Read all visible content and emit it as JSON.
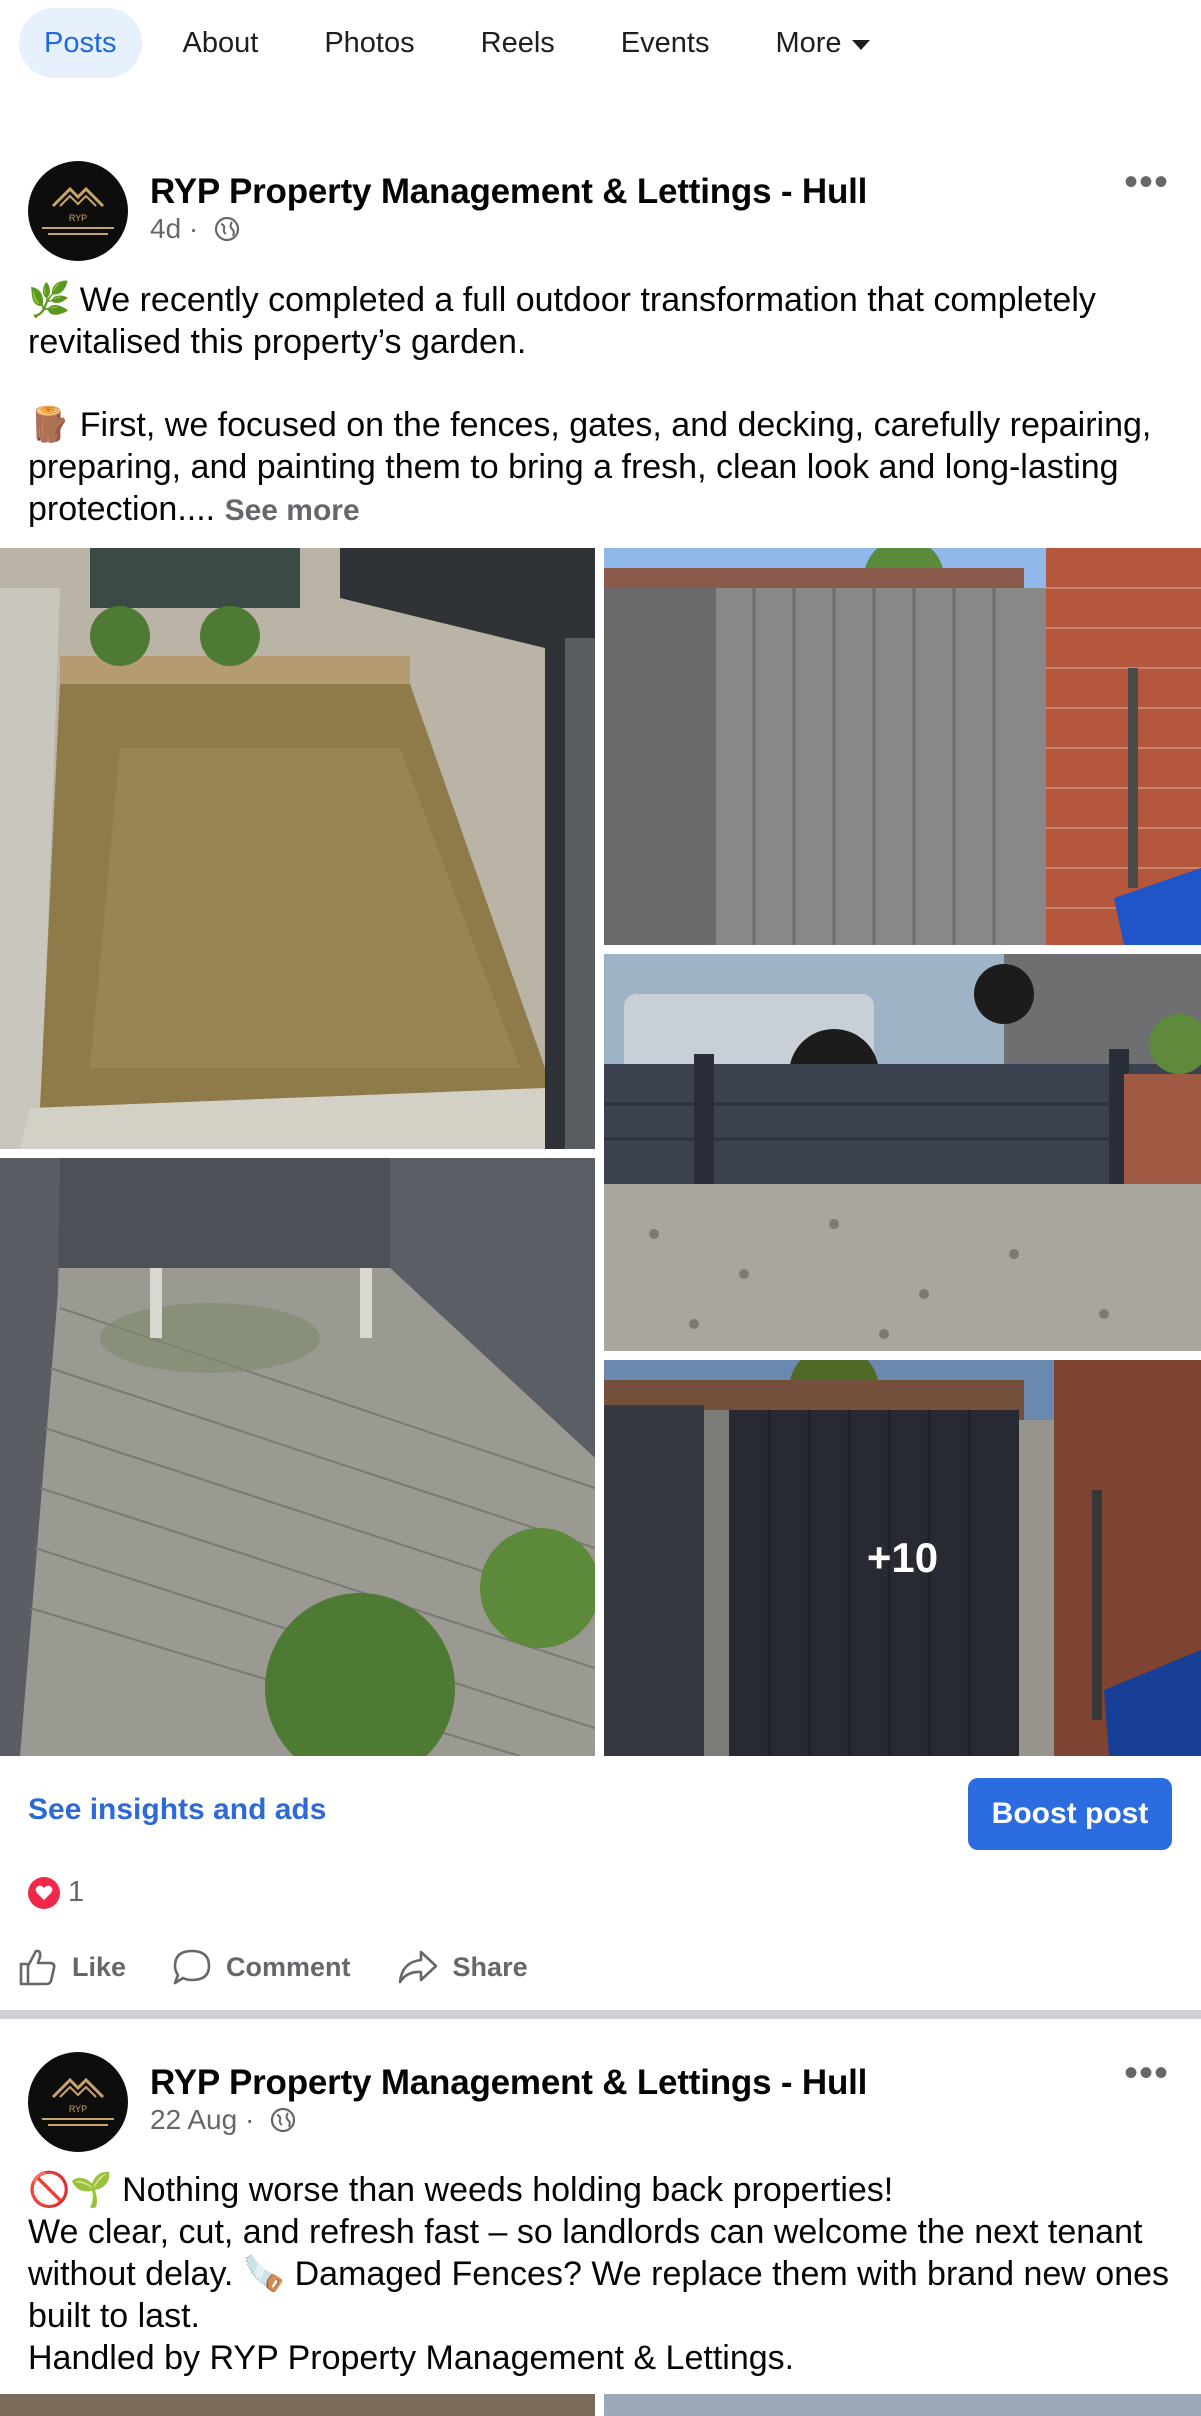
{
  "tabs": [
    {
      "label": "Posts"
    },
    {
      "label": "About"
    },
    {
      "label": "Photos"
    },
    {
      "label": "Reels"
    },
    {
      "label": "Events"
    },
    {
      "label": "More"
    }
  ],
  "posts": [
    {
      "page_name": "RYP Property Management & Lettings - Hull",
      "time": "4d",
      "paragraph1": "🌿 We recently completed a full outdoor transformation that completely revitalised this property’s garden.",
      "paragraph2": "🪵 First, we focused on the fences, gates, and decking, carefully repairing, preparing, and painting them to bring a fresh, clean look and long-lasting protection....",
      "see_more": "See more",
      "extra_photos": "+10",
      "insights_link": "See insights and ads",
      "boost_label": "Boost post",
      "reaction_count": "1",
      "actions": {
        "like": "Like",
        "comment": "Comment",
        "share": "Share"
      }
    },
    {
      "page_name": "RYP Property Management & Lettings - Hull",
      "time": "22 Aug",
      "line1": "🚫🌱 Nothing worse than weeds holding back properties!",
      "line2": "We clear, cut, and refresh fast – so landlords can welcome the next tenant without delay. 🪚 Damaged Fences? We replace them with brand new ones built to last.",
      "line3": "Handled by RYP Property Management & Lettings."
    }
  ],
  "avatar_logo_text": "RYP",
  "colors": {
    "accent": "#2b6ce0",
    "link": "#2d6ad5",
    "muted": "#65676b",
    "heart": "#f0284a"
  }
}
